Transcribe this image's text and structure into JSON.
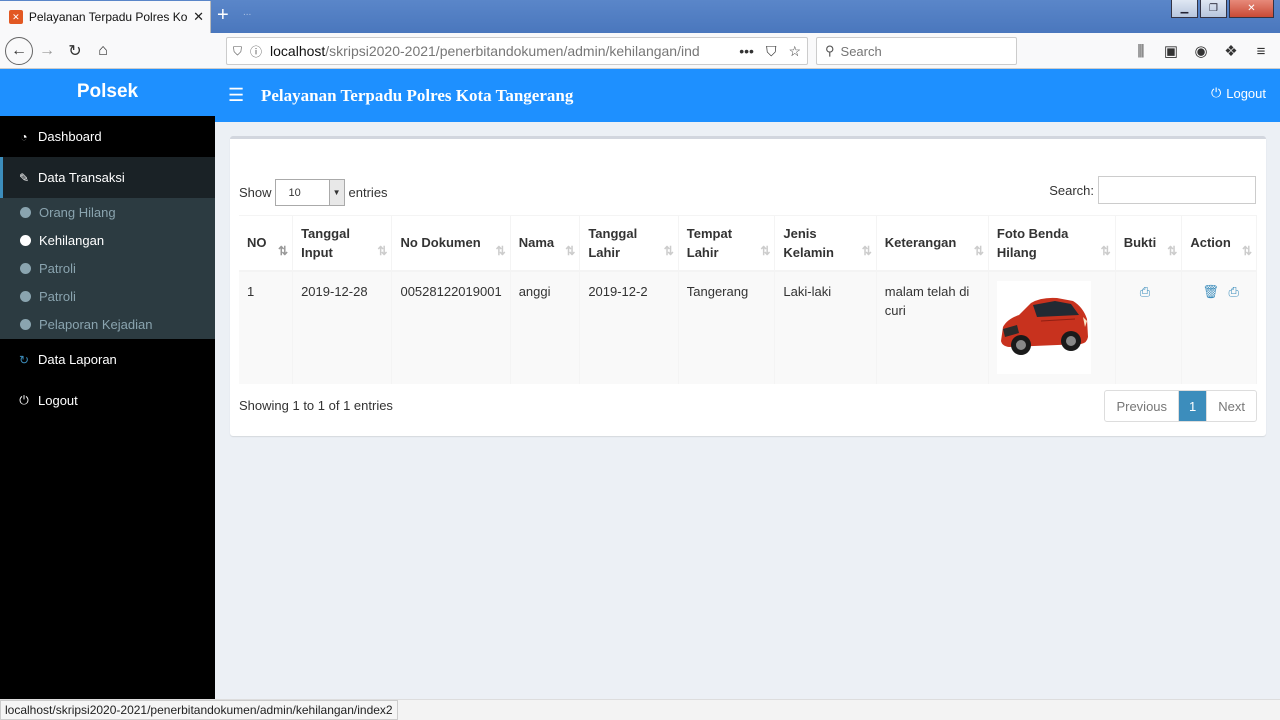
{
  "browser": {
    "tab_title": "Pelayanan Terpadu Polres Kota",
    "tab_ghost": "...",
    "url_host": "localhost",
    "url_path": "/skripsi2020-2021/penerbitandokumen/admin/kehilangan/inde",
    "search_placeholder": "Search",
    "status_url": "localhost/skripsi2020-2021/penerbitandokumen/admin/kehilangan/index2"
  },
  "app": {
    "logo": "Polsek",
    "title": "Pelayanan Terpadu Polres Kota Tangerang",
    "logout": "Logout"
  },
  "sidebar": {
    "dashboard": "Dashboard",
    "data_transaksi": "Data Transaksi",
    "sub_items": [
      "Orang Hilang",
      "Kehilangan",
      "Patroli",
      "Patroli",
      "Pelaporan Kejadian"
    ],
    "data_laporan": "Data Laporan",
    "logout": "Logout"
  },
  "table_controls": {
    "show": "Show",
    "length_value": "10",
    "entries": "entries",
    "search_label": "Search:"
  },
  "table": {
    "headers": [
      "NO",
      "Tanggal Input",
      "No Dokumen",
      "Nama",
      "Tanggal Lahir",
      "Tempat Lahir",
      "Jenis Kelamin",
      "Keterangan",
      "Foto Benda Hilang",
      "Bukti",
      "Action"
    ],
    "rows": [
      {
        "no": "1",
        "tanggal_input": "2019-12-28",
        "no_dokumen": "00528122019001",
        "nama": "anggi",
        "tanggal_lahir": "2019-12-2",
        "tempat_lahir": "Tangerang",
        "jenis_kelamin": "Laki-laki",
        "keterangan": "malam telah di curi"
      }
    ]
  },
  "footer": {
    "info": "Showing 1 to 1 of 1 entries",
    "previous": "Previous",
    "page": "1",
    "next": "Next"
  },
  "colors": {
    "header": "#1e90ff",
    "sidebar": "#000000",
    "submenu": "#2c3b41",
    "accent": "#3c8dbc"
  }
}
